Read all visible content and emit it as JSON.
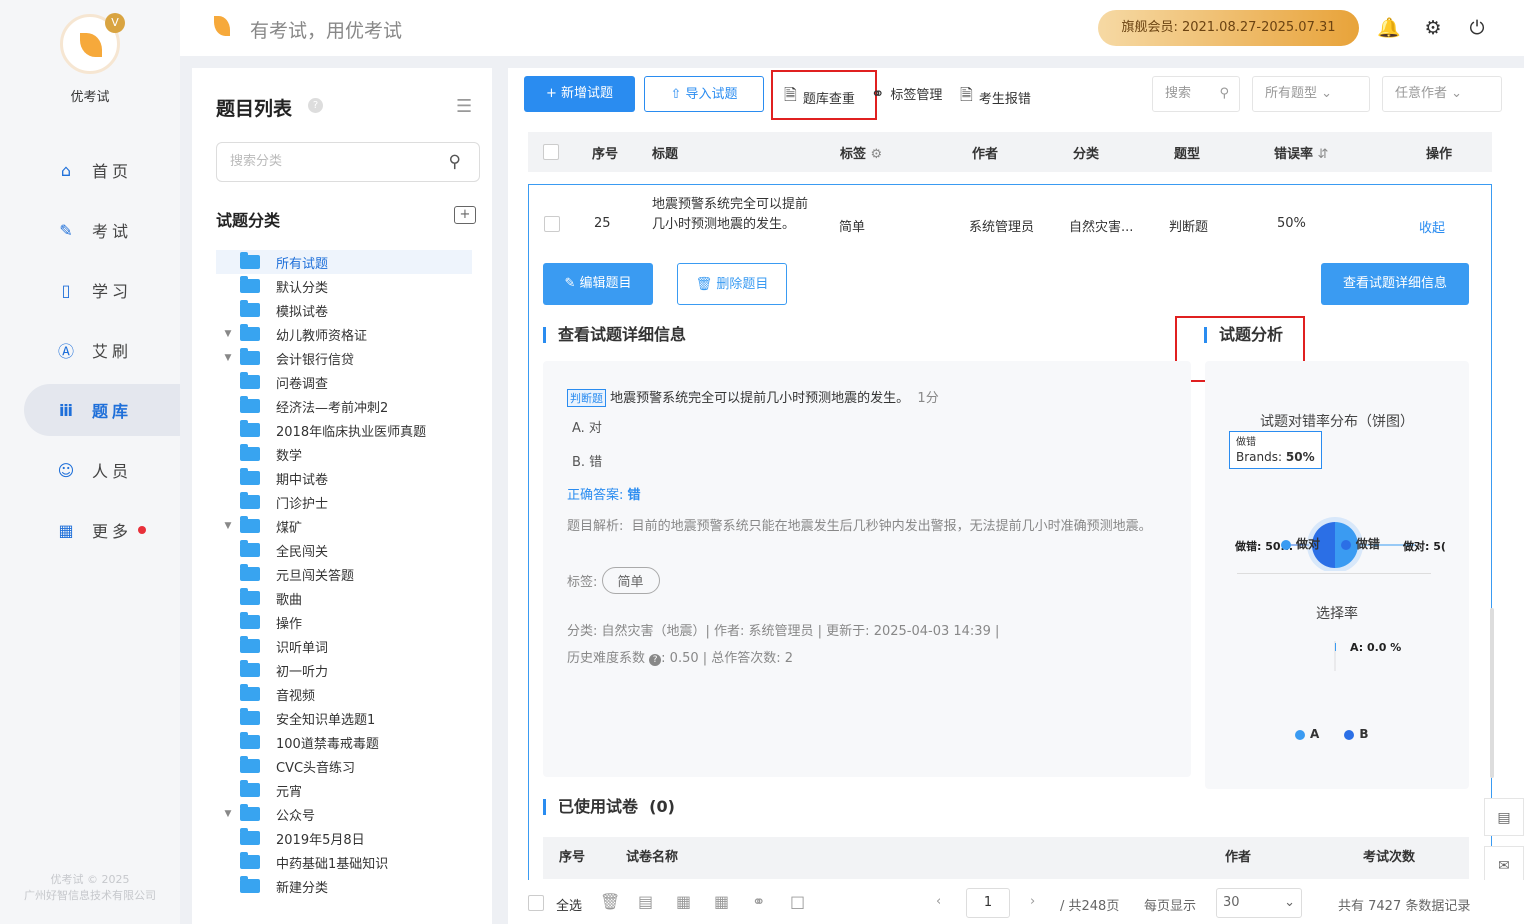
{
  "app": {
    "name": "优考试",
    "slogan": "有考试，用优考试",
    "copyright1": "优考试 © 2025",
    "copyright2": "广州好智信息技术有限公司",
    "vip": "旗舰会员: 2021.08.27-2025.07.31"
  },
  "nav": [
    {
      "label": "首页",
      "icon": "home-icon"
    },
    {
      "label": "考试",
      "icon": "exam-icon"
    },
    {
      "label": "学习",
      "icon": "book-icon"
    },
    {
      "label": "艾刷",
      "icon": "practice-icon"
    },
    {
      "label": "题库",
      "icon": "bank-icon"
    },
    {
      "label": "人员",
      "icon": "user-icon"
    },
    {
      "label": "更多",
      "icon": "more-icon"
    }
  ],
  "left": {
    "title": "题目列表",
    "search_placeholder": "搜索分类",
    "cat_title": "试题分类",
    "tree": [
      {
        "l": "所有试题",
        "a": ""
      },
      {
        "l": "默认分类",
        "a": ""
      },
      {
        "l": "模拟试卷",
        "a": ""
      },
      {
        "l": "幼儿教师资格证",
        "a": "▼"
      },
      {
        "l": "会计银行信贷",
        "a": "▼"
      },
      {
        "l": "问卷调查",
        "a": ""
      },
      {
        "l": "经济法—考前冲刺2",
        "a": ""
      },
      {
        "l": "2018年临床执业医师真题",
        "a": ""
      },
      {
        "l": "数学",
        "a": ""
      },
      {
        "l": "期中试卷",
        "a": ""
      },
      {
        "l": "门诊护士",
        "a": ""
      },
      {
        "l": "煤矿",
        "a": "▼"
      },
      {
        "l": "全民闯关",
        "a": ""
      },
      {
        "l": "元旦闯关答题",
        "a": ""
      },
      {
        "l": "歌曲",
        "a": ""
      },
      {
        "l": "操作",
        "a": ""
      },
      {
        "l": "识听单词",
        "a": ""
      },
      {
        "l": "初一听力",
        "a": ""
      },
      {
        "l": "音视频",
        "a": ""
      },
      {
        "l": "安全知识单选题1",
        "a": ""
      },
      {
        "l": "100道禁毒戒毒题",
        "a": ""
      },
      {
        "l": "CVC头音练习",
        "a": ""
      },
      {
        "l": "元宵",
        "a": ""
      },
      {
        "l": "公众号",
        "a": "▼"
      },
      {
        "l": "2019年5月8日",
        "a": ""
      },
      {
        "l": "中药基础1基础知识",
        "a": ""
      },
      {
        "l": "新建分类",
        "a": ""
      }
    ]
  },
  "toolbar": {
    "add": "新增试题",
    "import": "导入试题",
    "dup": "题库查重",
    "tags": "标签管理",
    "report": "考生报错",
    "search": "搜索",
    "type": "所有题型",
    "author": "任意作者"
  },
  "table": {
    "headers": [
      "序号",
      "标题",
      "标签",
      "作者",
      "分类",
      "题型",
      "错误率",
      "操作"
    ],
    "row": {
      "no": "25",
      "title": "地震预警系统完全可以提前几小时预测地震的发生。",
      "tag": "简单",
      "author": "系统管理员",
      "category": "自然灾害...",
      "type": "判断题",
      "rate": "50%",
      "action": "收起"
    }
  },
  "detail": {
    "edit": "编辑题目",
    "delete": "删除题目",
    "view": "查看试题详细信息",
    "sec1": "查看试题详细信息",
    "sec2": "试题分析",
    "qtag": "判断题",
    "question": "地震预警系统完全可以提前几小时预测地震的发生。",
    "score": "1分",
    "optA": "A. 对",
    "optB": "B. 错",
    "answer_label": "正确答案:",
    "answer": "错",
    "analysis_label": "题目解析:",
    "analysis": "目前的地震预警系统只能在地震发生后几秒钟内发出警报，无法提前几小时准确预测地震。",
    "tag_label": "标签:",
    "tag": "简单",
    "meta1": "分类: 自然灾害（地震）| 作者: 系统管理员 | 更新于: 2025-04-03 14:39 |",
    "meta2a": "历史难度系数",
    "meta2b": ": 0.50 | 总作答次数: 2",
    "used_title": "已使用试卷",
    "used_count": "(0)",
    "used_headers": [
      "序号",
      "试卷名称",
      "作者",
      "考试次数"
    ]
  },
  "chart_data": [
    {
      "type": "pie",
      "title": "试题对错率分布（饼图）",
      "categories": [
        "做对",
        "做错"
      ],
      "values": [
        50,
        50
      ],
      "colors": [
        "#3a9bf2",
        "#2b6fe6"
      ],
      "tooltip": {
        "name": "做错",
        "label": "Brands:",
        "value": "50%"
      },
      "labels": {
        "left": "做错: 50...",
        "right": "做对: 5("
      }
    },
    {
      "type": "bar",
      "title": "选择率",
      "categories": [
        "A",
        "B"
      ],
      "values": [
        0.0,
        null
      ],
      "data_label": "A: 0.0 %",
      "legend": [
        "A",
        "B"
      ],
      "colors": [
        "#3a9bf2",
        "#2b6fe6"
      ]
    }
  ],
  "footer": {
    "select_all": "全选",
    "page": "1",
    "total_pages": "/ 共248页",
    "per_page_label": "每页显示",
    "per_page": "30",
    "total": "共有 7427 条数据记录"
  }
}
